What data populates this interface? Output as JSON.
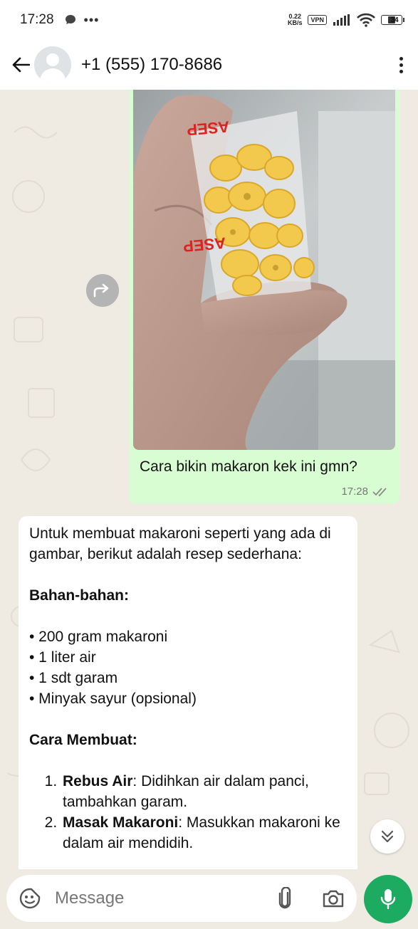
{
  "status_bar": {
    "time": "17:28",
    "net_speed_value": "0.22",
    "net_speed_unit": "KB/s",
    "vpn": "VPN",
    "battery": "34"
  },
  "header": {
    "title": "+1 (555) 170-8686"
  },
  "outgoing": {
    "photo_printed_text": "ASEP",
    "caption": "Cara bikin makaron kek ini gmn?",
    "time": "17:28",
    "bubble_color": "#d9fdd3"
  },
  "incoming": {
    "intro": "Untuk membuat makaroni seperti yang ada di gambar, berikut adalah resep sederhana:",
    "ingredients_title": "Bahan-bahan:",
    "ingredients": [
      "• 200 gram makaroni",
      "• 1 liter air",
      "• 1 sdt garam",
      "• Minyak sayur (opsional)"
    ],
    "steps_title": "Cara Membuat:",
    "steps": [
      {
        "bold": "Rebus Air",
        "text": ": Didihkan air dalam panci, tambahkan garam."
      },
      {
        "bold": "Masak Makaroni",
        "text": ": Masukkan makaroni ke dalam air mendidih."
      }
    ]
  },
  "input": {
    "placeholder": "Message"
  },
  "colors": {
    "accent_green": "#1daa61",
    "wallpaper": "#efeae2"
  }
}
